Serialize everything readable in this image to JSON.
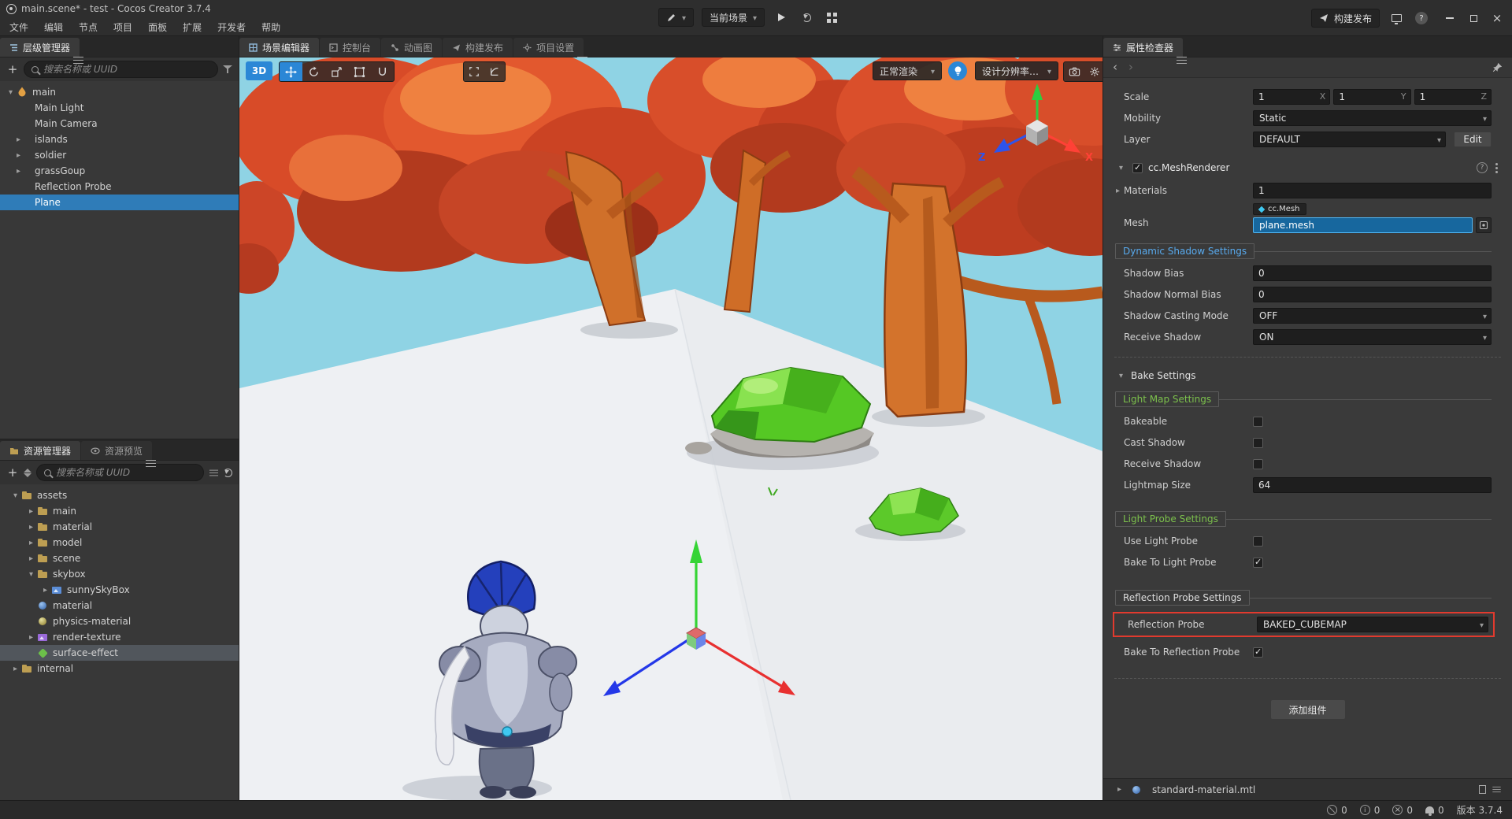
{
  "window": {
    "title": "main.scene* - test - Cocos Creator 3.7.4",
    "menus": [
      "文件",
      "编辑",
      "节点",
      "项目",
      "面板",
      "扩展",
      "开发者",
      "帮助"
    ],
    "topbar": {
      "scene_select": "当前场景",
      "build_button": "构建发布"
    }
  },
  "hierarchy": {
    "tab": "层级管理器",
    "search_placeholder": "搜索名称或 UUID",
    "nodes": [
      {
        "label": "main",
        "expanded": true
      },
      {
        "label": "Main Light"
      },
      {
        "label": "Main Camera"
      },
      {
        "label": "islands",
        "collapsed": true
      },
      {
        "label": "soldier",
        "collapsed": true
      },
      {
        "label": "grassGoup",
        "collapsed": true
      },
      {
        "label": "Reflection Probe"
      },
      {
        "label": "Plane",
        "selected": true
      }
    ]
  },
  "assets": {
    "tab_manager": "资源管理器",
    "tab_preview": "资源预览",
    "search_placeholder": "搜索名称或 UUID",
    "items": [
      {
        "label": "assets"
      },
      {
        "label": "main"
      },
      {
        "label": "material"
      },
      {
        "label": "model"
      },
      {
        "label": "scene"
      },
      {
        "label": "skybox"
      },
      {
        "label": "sunnySkyBox"
      },
      {
        "label": "material"
      },
      {
        "label": "physics-material"
      },
      {
        "label": "render-texture"
      },
      {
        "label": "surface-effect",
        "selected": true
      },
      {
        "label": "internal"
      }
    ]
  },
  "scene": {
    "tabs": [
      {
        "label": "场景编辑器",
        "active": true
      },
      {
        "label": "控制台"
      },
      {
        "label": "动画图"
      },
      {
        "label": "构建发布"
      },
      {
        "label": "项目设置"
      }
    ],
    "toolbar": {
      "mode": "3D",
      "render_mode": "正常渲染",
      "resolution": "设计分辨率…"
    },
    "gizmo_labels": {
      "x": "X",
      "z": "Z"
    }
  },
  "inspector": {
    "tab": "属性检查器",
    "scale": {
      "label": "Scale",
      "values": [
        "1",
        "1",
        "1"
      ],
      "axes": [
        "X",
        "Y",
        "Z"
      ]
    },
    "mobility": {
      "label": "Mobility",
      "value": "Static"
    },
    "layer": {
      "label": "Layer",
      "value": "DEFAULT",
      "edit": "Edit"
    },
    "mesh_renderer": {
      "title": "cc.MeshRenderer",
      "enabled": true,
      "materials_label": "Materials",
      "materials_value": "1",
      "mesh_label": "Mesh",
      "mesh_chip": "cc.Mesh",
      "mesh_value": "plane.mesh",
      "dynamic_shadow_title": "Dynamic Shadow Settings",
      "shadow_bias_label": "Shadow Bias",
      "shadow_bias": "0",
      "shadow_normal_bias_label": "Shadow Normal Bias",
      "shadow_normal_bias": "0",
      "shadow_casting_label": "Shadow Casting Mode",
      "shadow_casting": "OFF",
      "receive_shadow_label": "Receive Shadow",
      "receive_shadow": "ON"
    },
    "bake": {
      "title": "Bake Settings",
      "light_map_title": "Light Map Settings",
      "bakeable_label": "Bakeable",
      "bakeable": false,
      "cast_shadow_label": "Cast Shadow",
      "cast_shadow": false,
      "receive_shadow_label": "Receive Shadow",
      "receive_shadow": false,
      "lightmap_size_label": "Lightmap Size",
      "lightmap_size": "64",
      "light_probe_title": "Light Probe Settings",
      "use_light_probe_label": "Use Light Probe",
      "use_light_probe": false,
      "bake_to_light_probe_label": "Bake To Light Probe",
      "bake_to_light_probe": true,
      "reflection_title": "Reflection Probe Settings",
      "reflection_probe_label": "Reflection Probe",
      "reflection_probe": "BAKED_CUBEMAP",
      "bake_to_reflection_probe_label": "Bake To Reflection Probe",
      "bake_to_reflection_probe": true
    },
    "add_component": "添加组件",
    "material_footer": "standard-material.mtl"
  },
  "statusbar": {
    "counts": [
      "0",
      "0",
      "0",
      "0"
    ],
    "version": "版本 3.7.4"
  }
}
